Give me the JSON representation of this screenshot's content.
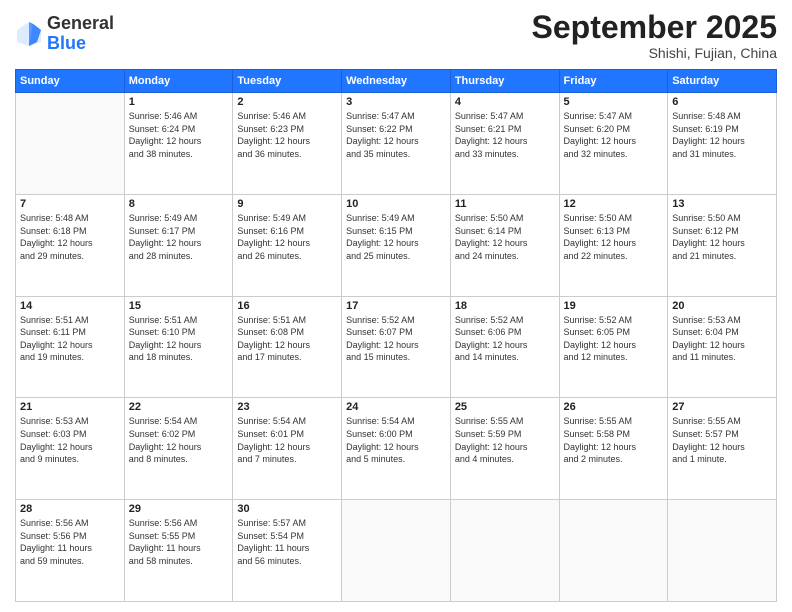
{
  "header": {
    "logo_general": "General",
    "logo_blue": "Blue",
    "month_title": "September 2025",
    "location": "Shishi, Fujian, China"
  },
  "weekdays": [
    "Sunday",
    "Monday",
    "Tuesday",
    "Wednesday",
    "Thursday",
    "Friday",
    "Saturday"
  ],
  "weeks": [
    [
      {
        "day": "",
        "info": ""
      },
      {
        "day": "1",
        "info": "Sunrise: 5:46 AM\nSunset: 6:24 PM\nDaylight: 12 hours\nand 38 minutes."
      },
      {
        "day": "2",
        "info": "Sunrise: 5:46 AM\nSunset: 6:23 PM\nDaylight: 12 hours\nand 36 minutes."
      },
      {
        "day": "3",
        "info": "Sunrise: 5:47 AM\nSunset: 6:22 PM\nDaylight: 12 hours\nand 35 minutes."
      },
      {
        "day": "4",
        "info": "Sunrise: 5:47 AM\nSunset: 6:21 PM\nDaylight: 12 hours\nand 33 minutes."
      },
      {
        "day": "5",
        "info": "Sunrise: 5:47 AM\nSunset: 6:20 PM\nDaylight: 12 hours\nand 32 minutes."
      },
      {
        "day": "6",
        "info": "Sunrise: 5:48 AM\nSunset: 6:19 PM\nDaylight: 12 hours\nand 31 minutes."
      }
    ],
    [
      {
        "day": "7",
        "info": "Sunrise: 5:48 AM\nSunset: 6:18 PM\nDaylight: 12 hours\nand 29 minutes."
      },
      {
        "day": "8",
        "info": "Sunrise: 5:49 AM\nSunset: 6:17 PM\nDaylight: 12 hours\nand 28 minutes."
      },
      {
        "day": "9",
        "info": "Sunrise: 5:49 AM\nSunset: 6:16 PM\nDaylight: 12 hours\nand 26 minutes."
      },
      {
        "day": "10",
        "info": "Sunrise: 5:49 AM\nSunset: 6:15 PM\nDaylight: 12 hours\nand 25 minutes."
      },
      {
        "day": "11",
        "info": "Sunrise: 5:50 AM\nSunset: 6:14 PM\nDaylight: 12 hours\nand 24 minutes."
      },
      {
        "day": "12",
        "info": "Sunrise: 5:50 AM\nSunset: 6:13 PM\nDaylight: 12 hours\nand 22 minutes."
      },
      {
        "day": "13",
        "info": "Sunrise: 5:50 AM\nSunset: 6:12 PM\nDaylight: 12 hours\nand 21 minutes."
      }
    ],
    [
      {
        "day": "14",
        "info": "Sunrise: 5:51 AM\nSunset: 6:11 PM\nDaylight: 12 hours\nand 19 minutes."
      },
      {
        "day": "15",
        "info": "Sunrise: 5:51 AM\nSunset: 6:10 PM\nDaylight: 12 hours\nand 18 minutes."
      },
      {
        "day": "16",
        "info": "Sunrise: 5:51 AM\nSunset: 6:08 PM\nDaylight: 12 hours\nand 17 minutes."
      },
      {
        "day": "17",
        "info": "Sunrise: 5:52 AM\nSunset: 6:07 PM\nDaylight: 12 hours\nand 15 minutes."
      },
      {
        "day": "18",
        "info": "Sunrise: 5:52 AM\nSunset: 6:06 PM\nDaylight: 12 hours\nand 14 minutes."
      },
      {
        "day": "19",
        "info": "Sunrise: 5:52 AM\nSunset: 6:05 PM\nDaylight: 12 hours\nand 12 minutes."
      },
      {
        "day": "20",
        "info": "Sunrise: 5:53 AM\nSunset: 6:04 PM\nDaylight: 12 hours\nand 11 minutes."
      }
    ],
    [
      {
        "day": "21",
        "info": "Sunrise: 5:53 AM\nSunset: 6:03 PM\nDaylight: 12 hours\nand 9 minutes."
      },
      {
        "day": "22",
        "info": "Sunrise: 5:54 AM\nSunset: 6:02 PM\nDaylight: 12 hours\nand 8 minutes."
      },
      {
        "day": "23",
        "info": "Sunrise: 5:54 AM\nSunset: 6:01 PM\nDaylight: 12 hours\nand 7 minutes."
      },
      {
        "day": "24",
        "info": "Sunrise: 5:54 AM\nSunset: 6:00 PM\nDaylight: 12 hours\nand 5 minutes."
      },
      {
        "day": "25",
        "info": "Sunrise: 5:55 AM\nSunset: 5:59 PM\nDaylight: 12 hours\nand 4 minutes."
      },
      {
        "day": "26",
        "info": "Sunrise: 5:55 AM\nSunset: 5:58 PM\nDaylight: 12 hours\nand 2 minutes."
      },
      {
        "day": "27",
        "info": "Sunrise: 5:55 AM\nSunset: 5:57 PM\nDaylight: 12 hours\nand 1 minute."
      }
    ],
    [
      {
        "day": "28",
        "info": "Sunrise: 5:56 AM\nSunset: 5:56 PM\nDaylight: 11 hours\nand 59 minutes."
      },
      {
        "day": "29",
        "info": "Sunrise: 5:56 AM\nSunset: 5:55 PM\nDaylight: 11 hours\nand 58 minutes."
      },
      {
        "day": "30",
        "info": "Sunrise: 5:57 AM\nSunset: 5:54 PM\nDaylight: 11 hours\nand 56 minutes."
      },
      {
        "day": "",
        "info": ""
      },
      {
        "day": "",
        "info": ""
      },
      {
        "day": "",
        "info": ""
      },
      {
        "day": "",
        "info": ""
      }
    ]
  ]
}
